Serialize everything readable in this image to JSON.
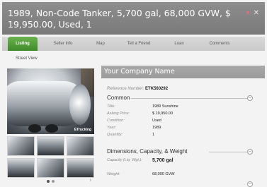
{
  "listing": {
    "title": "1989, Non-Code Tanker, 5,700 gal, 68,000 GVW, $ 19,950.00, Used, 1",
    "favorite_icon": "heart-icon",
    "close_icon": "close-icon"
  },
  "tabs": [
    {
      "label": "Listing",
      "active": true
    },
    {
      "label": "Seller Info",
      "active": false
    },
    {
      "label": "Map",
      "active": false
    },
    {
      "label": "Tell a Friend",
      "active": false
    },
    {
      "label": "Loan",
      "active": false
    },
    {
      "label": "Comments",
      "active": false
    }
  ],
  "subtab": {
    "label": "Street View"
  },
  "gallery": {
    "watermark": "ETrucking",
    "pager_next": "›"
  },
  "panel": {
    "company_name": "Your Company Name",
    "reference_label": "Reference Number:",
    "reference_value": "ETK560292",
    "common": {
      "heading": "Common",
      "rows": [
        {
          "label": "Title:",
          "value": "1989 Sunshine"
        },
        {
          "label": "Asking Price:",
          "value": "$ 19,950.00"
        },
        {
          "label": "Condition:",
          "value": "Used"
        },
        {
          "label": "Year:",
          "value": "1989"
        },
        {
          "label": "Quantity:",
          "value": "1"
        }
      ]
    },
    "dimensions": {
      "heading": "Dimensions, Capacity, & Weight",
      "rows": [
        {
          "label": "Capacity (Liq. Wgt.):",
          "value": "5,700 gal"
        },
        {
          "label": "Weight:",
          "value": "68,000 GVW"
        }
      ]
    },
    "collapse_symbol": "–"
  },
  "colors": {
    "header": "#858585",
    "active_tab": "#4e9b35",
    "panel_header": "#a2a2a2"
  }
}
